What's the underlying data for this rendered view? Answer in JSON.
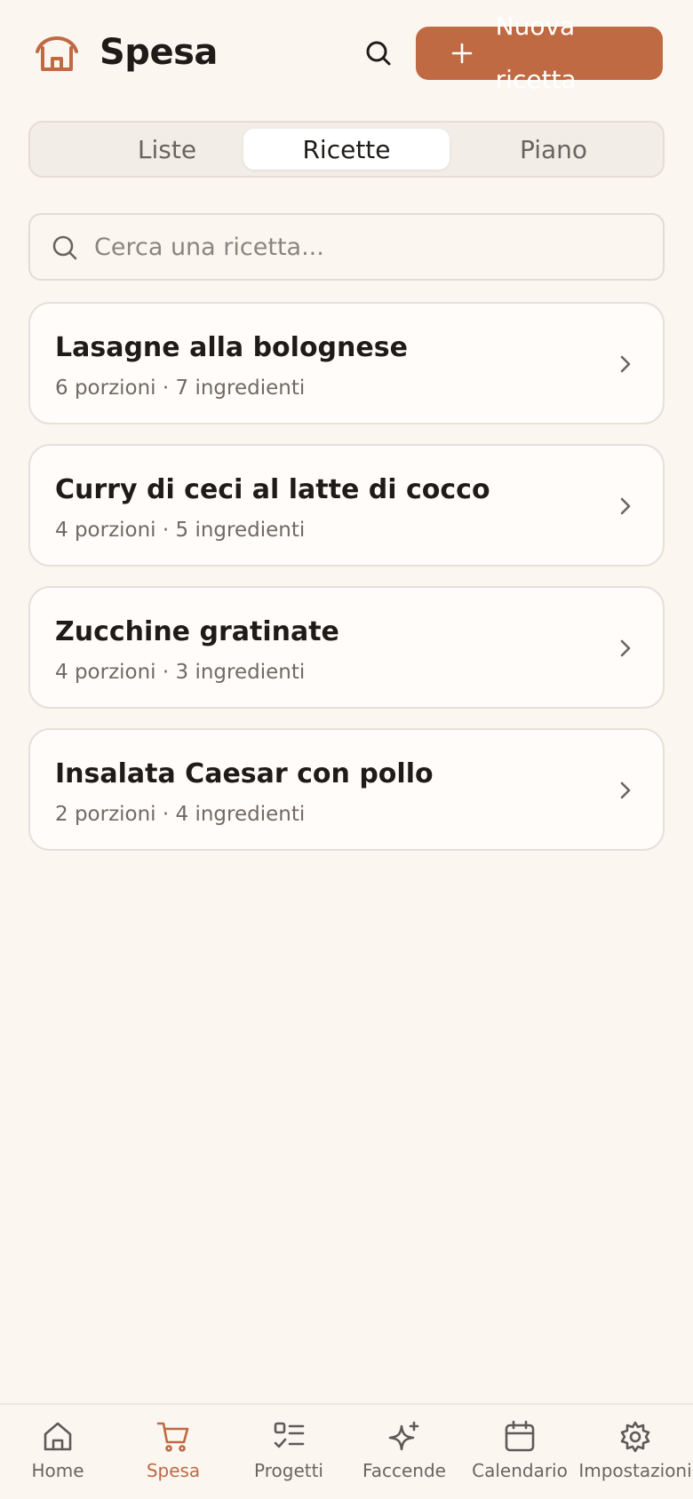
{
  "header": {
    "title": "Spesa",
    "new_button_label": "Nuova ricetta",
    "accent_color": "#bf6a42"
  },
  "tabs": [
    {
      "label": "Liste",
      "active": false
    },
    {
      "label": "Ricette",
      "active": true
    },
    {
      "label": "Piano",
      "active": false
    }
  ],
  "search": {
    "placeholder": "Cerca una ricetta...",
    "value": ""
  },
  "recipes": [
    {
      "name": "Lasagne alla bolognese",
      "meta": "6 porzioni · 7 ingredienti"
    },
    {
      "name": "Curry di ceci al latte di cocco",
      "meta": "4 porzioni · 5 ingredienti"
    },
    {
      "name": "Zucchine gratinate",
      "meta": "4 porzioni · 3 ingredienti"
    },
    {
      "name": "Insalata Caesar con pollo",
      "meta": "2 porzioni · 4 ingredienti"
    }
  ],
  "bottom_nav": [
    {
      "label": "Home",
      "icon": "home-icon",
      "active": false
    },
    {
      "label": "Spesa",
      "icon": "cart-icon",
      "active": true
    },
    {
      "label": "Progetti",
      "icon": "checklist-icon",
      "active": false
    },
    {
      "label": "Faccende",
      "icon": "sparkles-icon",
      "active": false
    },
    {
      "label": "Calendario",
      "icon": "calendar-icon",
      "active": false
    },
    {
      "label": "Impostazioni",
      "icon": "gear-icon",
      "active": false
    }
  ]
}
